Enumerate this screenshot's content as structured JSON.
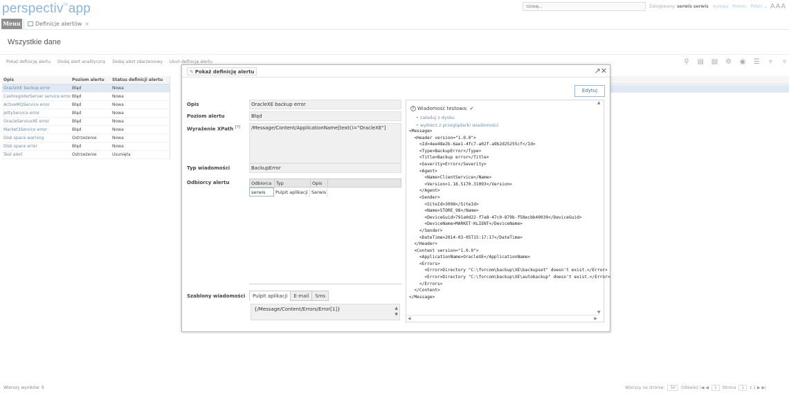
{
  "app": {
    "logo_text": "perspectiv",
    "logo_sup": "tm",
    "logo_suffix": "app",
    "search_placeholder": "Szukaj...",
    "logged_label": "Zalogowany:",
    "user": "serwis serwis",
    "logout": "wyloguj",
    "help": "Pomoc",
    "language": "Polski",
    "font_size": "AAA"
  },
  "nav": {
    "menu": "Menu",
    "tab": "Definicje alertów"
  },
  "page": {
    "title": "Wszystkie dane",
    "actions": [
      "Pokaż definicję alertu",
      "Dodaj alert analityczny",
      "Dodaj alert zdarzeniowy",
      "Usuń definicję alertu"
    ]
  },
  "grid": {
    "columns": [
      "Opis",
      "Poziom alertu",
      "Status definicji alertu"
    ],
    "rows": [
      [
        "OracleXE backup error",
        "Błąd",
        "Nowa"
      ],
      [
        "CashregisterServer service error",
        "Błąd",
        "Nowa"
      ],
      [
        "ActiveMQService error",
        "Błąd",
        "Nowa"
      ],
      [
        "JettyService error",
        "Błąd",
        "Nowa"
      ],
      [
        "OracleServiceXE error",
        "Błąd",
        "Nowa"
      ],
      [
        "Market3Service error",
        "Błąd",
        "Nowa"
      ],
      [
        "Disk space warning",
        "Ostrzeżenie",
        "Nowa"
      ],
      [
        "Disk space error",
        "Błąd",
        "Nowa"
      ],
      [
        "Test alert",
        "Ostrzeżenie",
        "Usunięta"
      ]
    ]
  },
  "footer": {
    "results": "Wierszy wyników: 9",
    "rows_per_page": "Wierszy na stronie:",
    "rows_value": "50",
    "refresh": "Odśwież",
    "page_label": "Strona",
    "page_value": "1",
    "page_of": "z 1"
  },
  "dialog": {
    "title": "Pokaż definicję alertu",
    "edit": "Edytuj",
    "labels": {
      "opis": "Opis",
      "poziom": "Poziom alertu",
      "xpath": "Wyrażenie XPath",
      "xpath_help": "[?]",
      "typ": "Typ wiadomości",
      "odbiorcy": "Odbiorcy alertu",
      "szablony": "Szablony wiadomości"
    },
    "values": {
      "opis": "OracleXE backup error",
      "poziom": "Błąd",
      "xpath": "/Message/Content/ApplicationName[text()=\"OracleXE\"]",
      "typ": "BackupError"
    },
    "recipients": {
      "columns": [
        "Odbiorca",
        "Typ",
        "Opis"
      ],
      "row": [
        "serwis",
        "Pulpit aplikacji",
        "Serwis"
      ]
    },
    "templates": {
      "tabs": [
        "Pulpit aplikacji",
        "E-mail",
        "Sms"
      ],
      "content": "{/Message/Content/Errors/Error[1]}"
    },
    "test": {
      "label": "Wiadomość testowa:",
      "load_disk": "załaduj z dysku",
      "choose_browser": "wybierz z przeglądarki wiadomości"
    },
    "xml_lines": [
      "<Message>",
      "  <Header version=\"1.0.0\">",
      "    <Id>4ee48e2b-6ae1-4fc7-a02f-a9b2d25255cf</Id>",
      "    <Type>BackupError</Type>",
      "    <Title>Backup error</Title>",
      "    <Severity>Error</Severity>",
      "    <Agent>",
      "      <Name>ClientService</Name>",
      "      <Version>1.18.5170.31093</Version>",
      "    </Agent>",
      "    <Sender>",
      "      <SiteId>3098</SiteId>",
      "      <Name>STORE_98</Name>",
      "      <DeviceGuid>791a0d22-f7a8-47c0-879b-f58ecbb49039</DeviceGuid>",
      "      <DeviceName>MARKET-KLIENT</DeviceName>",
      "    </Sender>",
      "    <DateTime>2014-03-05T15:17:17</DateTime>",
      "  </Header>",
      "  <Content version=\"1.0.0\">",
      "    <ApplicationName>OracleXE</ApplicationName>",
      "    <Errors>",
      "      <Error>Directory \"C:\\forcom\\backup\\XE\\backupset\" doesn't exist.</Error>",
      "      <Error>Directory \"C:\\forcom\\backup\\XE\\autobackup\" doesn't exist.</Error>",
      "    </Errors>",
      "  </Content>",
      "</Message>"
    ]
  }
}
